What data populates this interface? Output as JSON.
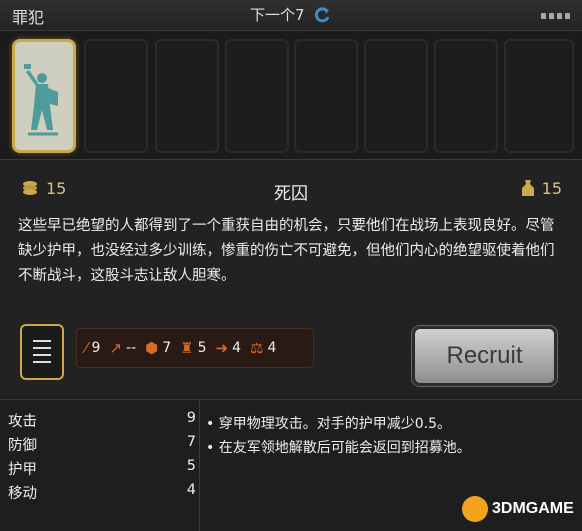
{
  "header": {
    "title": "罪犯",
    "next_label": "下一个7"
  },
  "unit": {
    "name": "死囚",
    "gold_cost": "15",
    "supply_cost": "15",
    "description": "这些早已绝望的人都得到了一个重获自由的机会，只要他们在战场上表现良好。尽管缺少护甲，也没经过多少训练，惨重的伤亡不可避免，但他们内心的绝望驱使着他们不断战斗，这股斗志让敌人胆寒。"
  },
  "stats": [
    {
      "icon": "sword-icon",
      "value": "9"
    },
    {
      "icon": "spear-icon",
      "value": "--"
    },
    {
      "icon": "shield-icon",
      "value": "7"
    },
    {
      "icon": "armor-icon",
      "value": "5"
    },
    {
      "icon": "arrow-icon",
      "value": "4"
    },
    {
      "icon": "scale-icon",
      "value": "4"
    }
  ],
  "recruit_label": "Recruit",
  "attributes": [
    {
      "label": "攻击",
      "value": "9"
    },
    {
      "label": "防御",
      "value": "7"
    },
    {
      "label": "护甲",
      "value": "5"
    },
    {
      "label": "移动",
      "value": "4"
    }
  ],
  "traits": [
    "• 穿甲物理攻击。对手的护甲减少0.5。",
    "• 在友军领地解散后可能会返回到招募池。"
  ],
  "watermark": "3DMGAME",
  "colors": {
    "gold_border": "#c9a94a",
    "stat_icon": "#d66a2b",
    "background": "#1e1e1e"
  }
}
